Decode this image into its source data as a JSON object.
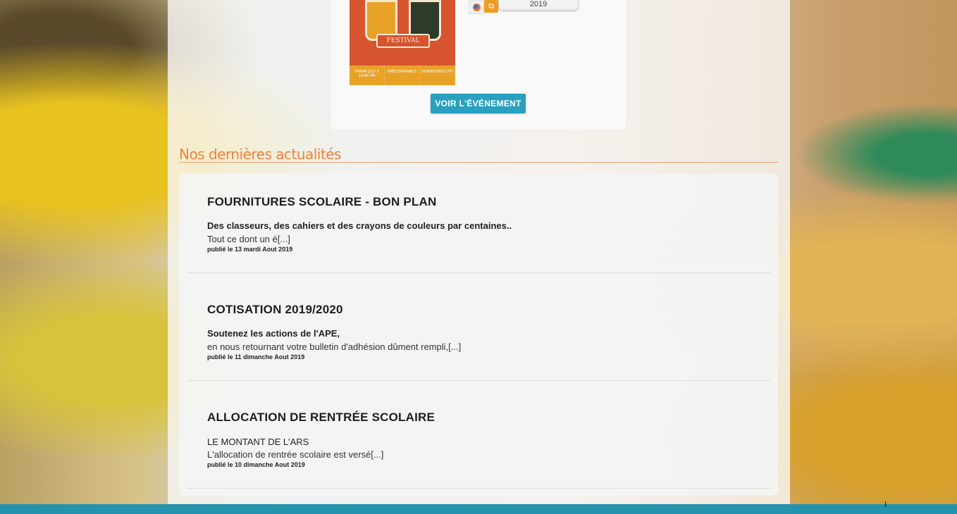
{
  "event": {
    "year": "2019",
    "poster": {
      "ribbon_text": "FESTIVAL",
      "strip": [
        "FRIDAY JULY 3 14:00 PM",
        "FREE ENTRANCE",
        "DOWNTOWN CITY"
      ]
    },
    "view_button": "VOIR L'ÉVÉNEMENT"
  },
  "news": {
    "heading": "Nos dernières actualités",
    "items": [
      {
        "title": "FOURNITURES SCOLAIRE - BON PLAN",
        "lead": "Des classeurs, des cahiers et des crayons de couleurs par centaines..",
        "excerpt": "Tout ce dont un é[...]",
        "date": "publié le 13 mardi Aout 2019"
      },
      {
        "title": "COTISATION 2019/2020",
        "lead": "Soutenez les actions de l'APE,",
        "excerpt": "en nous retournant votre bulletin d'adhésion dûment rempli,[...]",
        "date": "publié le 11 dimanche Aout 2019"
      },
      {
        "title": "ALLOCATION DE RENTRÉE SCOLAIRE",
        "lead": "LE MONTANT DE L'ARS",
        "excerpt": "L'allocation de rentrée scolaire est versé[...]",
        "date": "publié le 10 dimanche Aout 2019"
      }
    ]
  },
  "colors": {
    "accent_orange": "#f0803c",
    "button_blue": "#2aa0c1",
    "footer_blue": "#2593ad"
  },
  "icons": [
    "firefox-icon",
    "copy-icon"
  ]
}
